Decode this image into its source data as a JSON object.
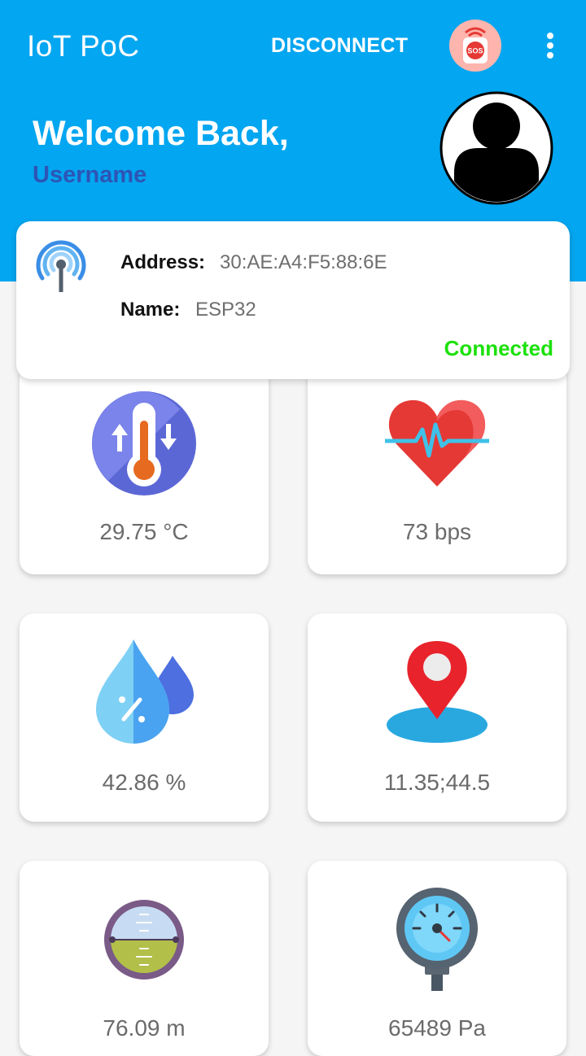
{
  "app_bar": {
    "title": "IoT PoC",
    "disconnect_label": "DISCONNECT",
    "sos_icon": "sos-button-icon",
    "sos_text": "SOS",
    "menu_icon": "more-vert-icon"
  },
  "welcome": {
    "greeting": "Welcome Back,",
    "username": "Username",
    "avatar_icon": "person-avatar-icon"
  },
  "device": {
    "icon": "wifi-antenna-icon",
    "address_label": "Address:",
    "address_value": "30:AE:A4:F5:88:6E",
    "name_label": "Name:",
    "name_value": "ESP32",
    "status": "Connected"
  },
  "sensors": [
    {
      "icon": "thermometer-icon",
      "value": "29.75 °C"
    },
    {
      "icon": "heart-rate-icon",
      "value": "73 bps"
    },
    {
      "icon": "humidity-drop-icon",
      "value": "42.86 %"
    },
    {
      "icon": "location-pin-icon",
      "value": "11.35;44.5"
    },
    {
      "icon": "altimeter-icon",
      "value": "76.09 m"
    },
    {
      "icon": "pressure-gauge-icon",
      "value": "65489 Pa"
    }
  ],
  "colors": {
    "primary": "#03a6f0",
    "accent_username": "#2d55b5",
    "status_connected": "#1ce10c",
    "background": "#f5f5f5"
  }
}
